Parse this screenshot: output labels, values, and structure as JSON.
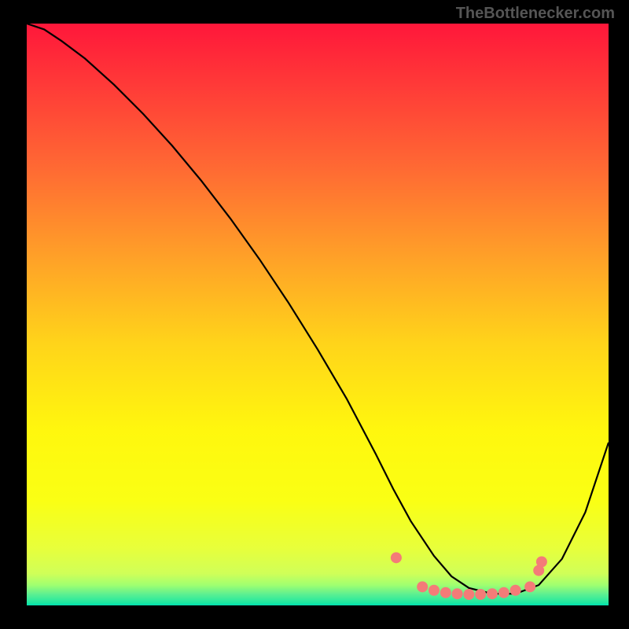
{
  "watermark": "TheBottlenecker.com",
  "chart_data": {
    "type": "line",
    "title": "",
    "xlabel": "",
    "ylabel": "",
    "xlim": [
      0,
      100
    ],
    "ylim": [
      0,
      100
    ],
    "background_gradient": {
      "stops": [
        {
          "offset": 0.0,
          "color": "#ff173a"
        },
        {
          "offset": 0.1,
          "color": "#ff3838"
        },
        {
          "offset": 0.25,
          "color": "#ff6a33"
        },
        {
          "offset": 0.4,
          "color": "#ffa028"
        },
        {
          "offset": 0.55,
          "color": "#ffd41a"
        },
        {
          "offset": 0.7,
          "color": "#fff70e"
        },
        {
          "offset": 0.82,
          "color": "#faff14"
        },
        {
          "offset": 0.9,
          "color": "#e8ff3a"
        },
        {
          "offset": 0.945,
          "color": "#d0ff58"
        },
        {
          "offset": 0.965,
          "color": "#a0ff70"
        },
        {
          "offset": 0.98,
          "color": "#60f090"
        },
        {
          "offset": 0.995,
          "color": "#20e8a0"
        },
        {
          "offset": 1.0,
          "color": "#00e0b0"
        }
      ]
    },
    "series": [
      {
        "name": "bottleneck-curve",
        "x": [
          0,
          3,
          6,
          10,
          15,
          20,
          25,
          30,
          35,
          40,
          45,
          50,
          55,
          60,
          63,
          66,
          70,
          73,
          76,
          80,
          84,
          88,
          92,
          96,
          100
        ],
        "values": [
          100,
          99,
          97,
          94,
          89.5,
          84.5,
          79,
          73,
          66.5,
          59.5,
          52,
          44,
          35.5,
          26,
          20,
          14.5,
          8.5,
          5,
          3,
          2,
          2,
          3.5,
          8,
          16,
          28
        ]
      }
    ],
    "markers": {
      "name": "optimal-range",
      "color": "#f47b78",
      "points": [
        {
          "x": 63.5,
          "y": 8.2
        },
        {
          "x": 68,
          "y": 3.2
        },
        {
          "x": 70,
          "y": 2.6
        },
        {
          "x": 72,
          "y": 2.2
        },
        {
          "x": 74,
          "y": 2.0
        },
        {
          "x": 76,
          "y": 1.9
        },
        {
          "x": 78,
          "y": 1.9
        },
        {
          "x": 80,
          "y": 2.0
        },
        {
          "x": 82,
          "y": 2.2
        },
        {
          "x": 84,
          "y": 2.6
        },
        {
          "x": 86.5,
          "y": 3.2
        },
        {
          "x": 88,
          "y": 6.0
        },
        {
          "x": 88.5,
          "y": 7.5
        }
      ]
    }
  }
}
